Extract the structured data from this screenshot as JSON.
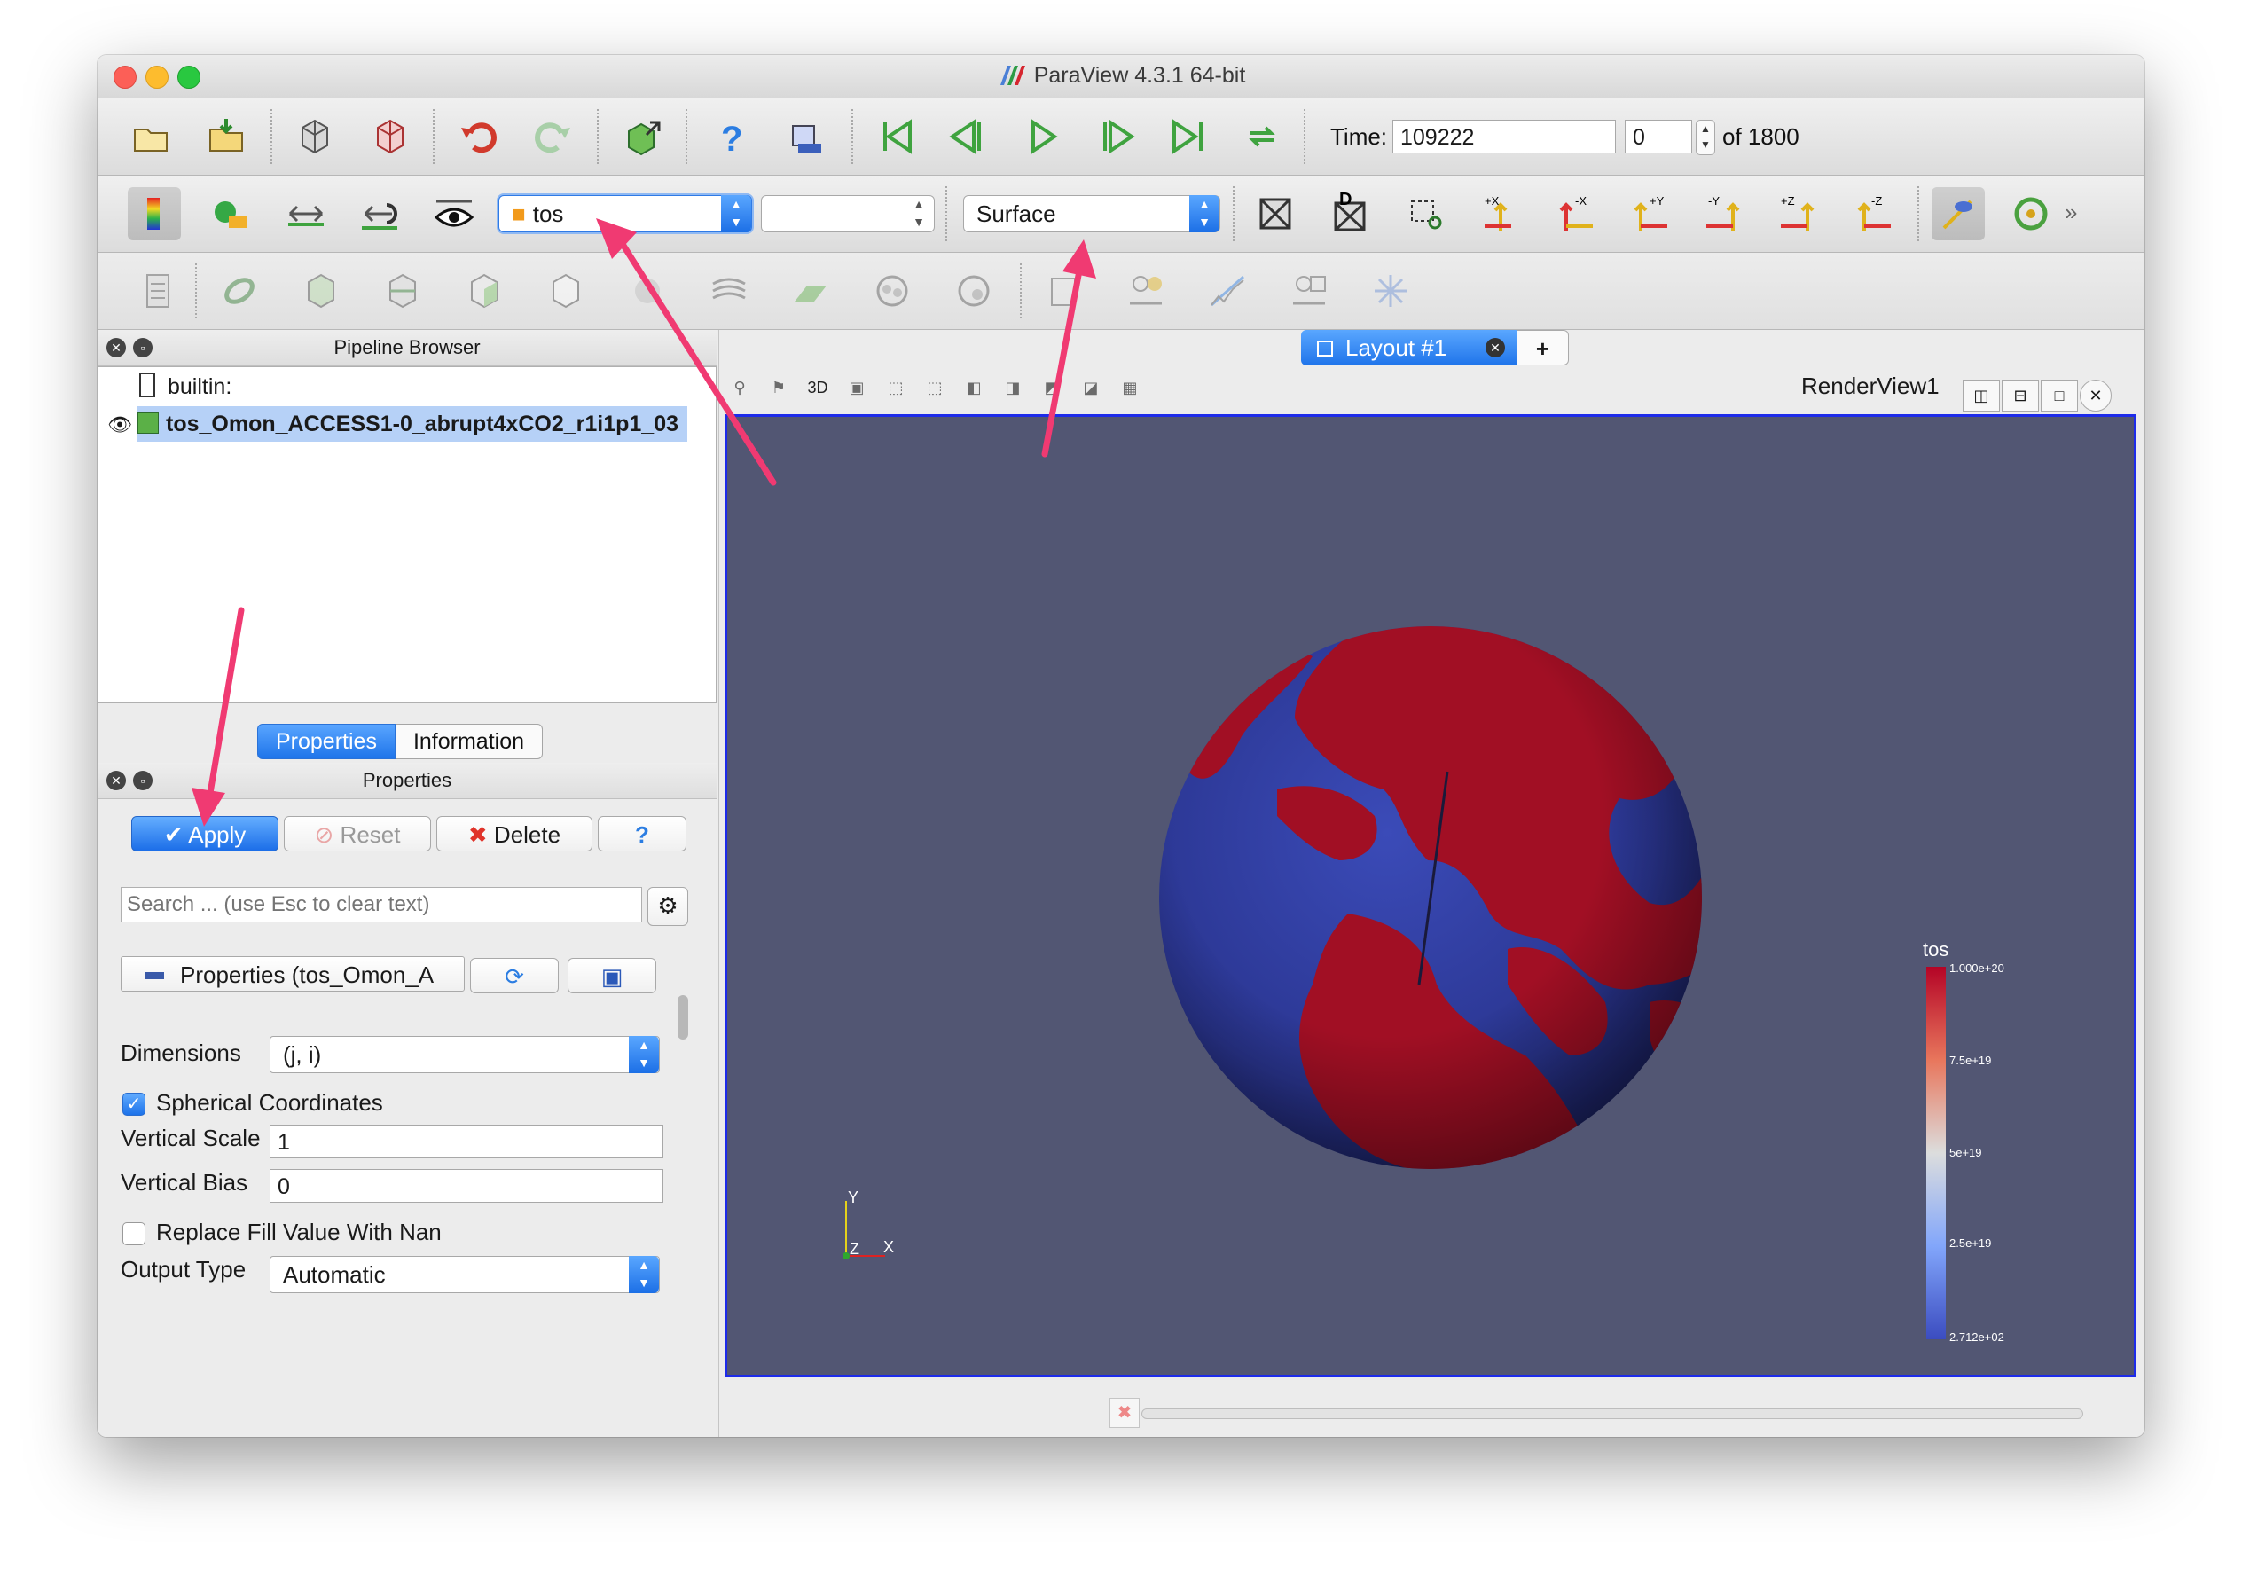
{
  "window": {
    "title": "ParaView 4.3.1 64-bit"
  },
  "time_toolbar": {
    "time_label": "Time:",
    "time_value": "109222",
    "step_value": "0",
    "of_label": "of 1800"
  },
  "representation": {
    "array_value": "tos",
    "component_value": "",
    "representation_value": "Surface"
  },
  "pipeline_browser": {
    "title": "Pipeline Browser",
    "items": [
      {
        "label": "builtin:"
      },
      {
        "label": "tos_Omon_ACCESS1-0_abrupt4xCO2_r1i1p1_03"
      }
    ]
  },
  "tabs": {
    "properties": "Properties",
    "information": "Information"
  },
  "properties_panel": {
    "title": "Properties",
    "apply": "Apply",
    "reset": "Reset",
    "delete": "Delete",
    "help": "?",
    "search_placeholder": "Search ... (use Esc to clear text)",
    "section_label": "Properties (tos_Omon_A",
    "dimensions_label": "Dimensions",
    "dimensions_value": "(j, i)",
    "spherical_label": "Spherical Coordinates",
    "spherical_checked": true,
    "vertical_scale_label": "Vertical Scale",
    "vertical_scale_value": "1",
    "vertical_bias_label": "Vertical Bias",
    "vertical_bias_value": "0",
    "replace_fill_label": "Replace Fill Value With Nan",
    "replace_fill_checked": false,
    "output_type_label": "Output Type",
    "output_type_value": "Automatic"
  },
  "layout": {
    "tab_label": "Layout #1",
    "add_label": "+",
    "view_name": "RenderView1",
    "three_d_label": "3D"
  },
  "colorbar": {
    "title": "tos",
    "ticks": [
      "1.000e+20",
      "7.5e+19",
      "5e+19",
      "2.5e+19",
      "2.712e+02"
    ]
  },
  "axes": {
    "y": "Y",
    "x": "X",
    "z": "Z"
  },
  "colors": {
    "accent_blue": "#1f74ea",
    "annotation_pink": "#f03a72",
    "viewport_bg": "#525673",
    "land_red": "#a10f24",
    "ocean_blue": "#2e3a9b"
  }
}
